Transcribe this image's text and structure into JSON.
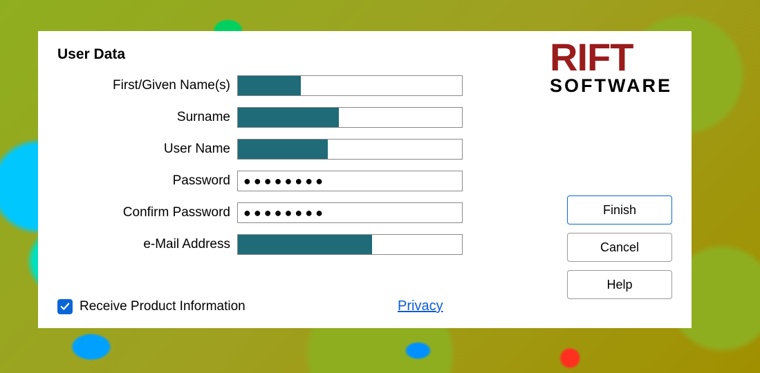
{
  "header": "User Data",
  "logo": {
    "line1": "RIFT",
    "line2": "SOFTWARE"
  },
  "fields": {
    "first_name": {
      "label": "First/Given Name(s)",
      "fill_pct": 28
    },
    "surname": {
      "label": "Surname",
      "fill_pct": 45
    },
    "user_name": {
      "label": "User Name",
      "fill_pct": 40
    },
    "password": {
      "label": "Password",
      "dots": "●●●●●●●●"
    },
    "confirm": {
      "label": "Confirm Password",
      "dots": "●●●●●●●●"
    },
    "email": {
      "label": "e-Mail Address",
      "fill_pct": 60
    }
  },
  "receive_info": {
    "label": "Receive Product Information",
    "checked": true
  },
  "privacy_label": "Privacy",
  "buttons": {
    "finish": "Finish",
    "cancel": "Cancel",
    "help": "Help"
  },
  "colors": {
    "accent_fill": "#1f6b78",
    "link": "#0a5ad6",
    "primary_border": "#0a66d6",
    "logo_red": "#9a1c1c"
  }
}
